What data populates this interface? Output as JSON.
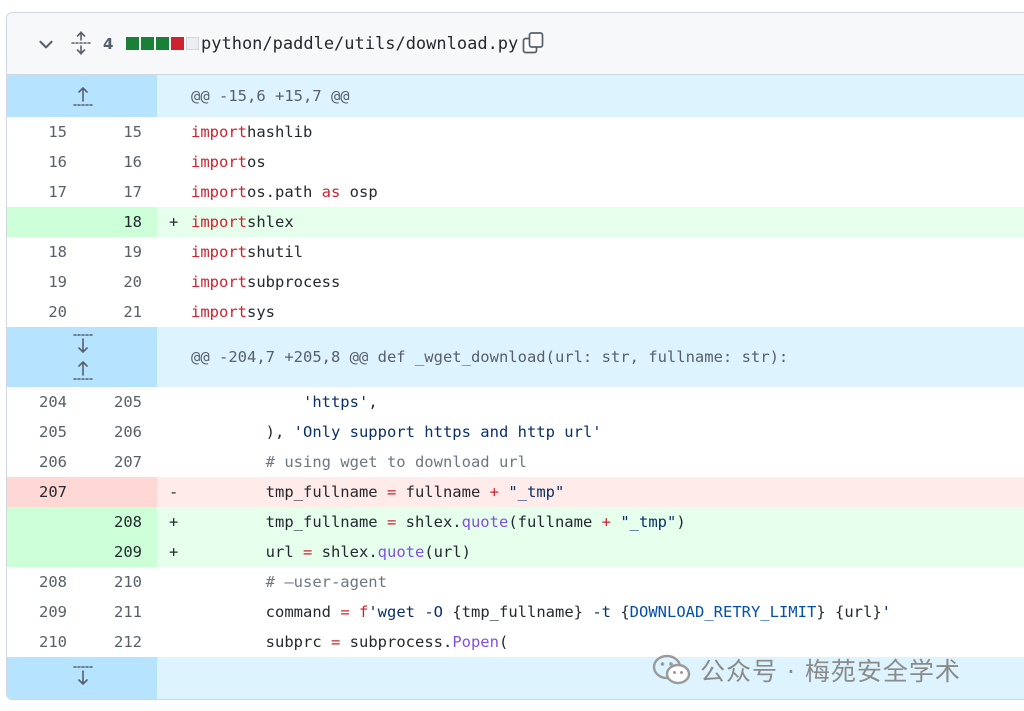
{
  "file": {
    "changes_count": "4",
    "diffstat": [
      "#1a7f37",
      "#1a7f37",
      "#1a7f37",
      "#cf222e",
      "#eaeef2"
    ],
    "path": "python/paddle/utils/download.py"
  },
  "hunk1": {
    "header": "@@ -15,6 +15,7 @@"
  },
  "hunk2": {
    "header": "@@ -204,7 +205,8 @@ def _wget_download(url: str, fullname: str):"
  },
  "block1": [
    {
      "old": "15",
      "new": "15",
      "type": "ctx",
      "tokens": [
        [
          "kw",
          "import"
        ],
        [
          "",
          "hashlib"
        ]
      ]
    },
    {
      "old": "16",
      "new": "16",
      "type": "ctx",
      "tokens": [
        [
          "kw",
          "import"
        ],
        [
          "",
          "os"
        ]
      ]
    },
    {
      "old": "17",
      "new": "17",
      "type": "ctx",
      "tokens": [
        [
          "kw",
          "import"
        ],
        [
          "",
          "os.path "
        ],
        [
          "kw",
          "as"
        ],
        [
          "",
          " osp"
        ]
      ]
    },
    {
      "old": "",
      "new": "18",
      "type": "add",
      "sign": "+",
      "tokens": [
        [
          "kw",
          "import"
        ],
        [
          "",
          "shlex"
        ]
      ]
    },
    {
      "old": "18",
      "new": "19",
      "type": "ctx",
      "tokens": [
        [
          "kw",
          "import"
        ],
        [
          "",
          "shutil"
        ]
      ]
    },
    {
      "old": "19",
      "new": "20",
      "type": "ctx",
      "tokens": [
        [
          "kw",
          "import"
        ],
        [
          "",
          "subprocess"
        ]
      ]
    },
    {
      "old": "20",
      "new": "21",
      "type": "ctx",
      "tokens": [
        [
          "kw",
          "import"
        ],
        [
          "",
          "sys"
        ]
      ]
    }
  ],
  "block2": [
    {
      "old": "204",
      "new": "205",
      "type": "ctx",
      "tokens": [
        [
          "",
          "            "
        ],
        [
          "str",
          "'https'"
        ],
        [
          "",
          ","
        ]
      ]
    },
    {
      "old": "205",
      "new": "206",
      "type": "ctx",
      "tokens": [
        [
          "",
          "        ), "
        ],
        [
          "str",
          "'Only support https and http url'"
        ]
      ]
    },
    {
      "old": "206",
      "new": "207",
      "type": "ctx",
      "tokens": [
        [
          "cm",
          "        # using wget to download url"
        ]
      ]
    },
    {
      "old": "207",
      "new": "",
      "type": "del",
      "sign": "-",
      "tokens": [
        [
          "",
          "        tmp_fullname "
        ],
        [
          "op",
          "="
        ],
        [
          "",
          " fullname "
        ],
        [
          "op",
          "+"
        ],
        [
          "",
          " "
        ],
        [
          "str",
          "\"_tmp\""
        ]
      ]
    },
    {
      "old": "",
      "new": "208",
      "type": "add",
      "sign": "+",
      "tokens": [
        [
          "",
          "        tmp_fullname "
        ],
        [
          "op",
          "="
        ],
        [
          "",
          " shlex."
        ],
        [
          "fn",
          "quote"
        ],
        [
          "",
          "(fullname "
        ],
        [
          "op",
          "+"
        ],
        [
          "",
          " "
        ],
        [
          "str",
          "\"_tmp\""
        ],
        [
          "",
          ")"
        ]
      ]
    },
    {
      "old": "",
      "new": "209",
      "type": "add",
      "sign": "+",
      "tokens": [
        [
          "",
          "        url "
        ],
        [
          "op",
          "="
        ],
        [
          "",
          " shlex."
        ],
        [
          "fn",
          "quote"
        ],
        [
          "",
          "(url)"
        ]
      ]
    },
    {
      "old": "208",
      "new": "210",
      "type": "ctx",
      "tokens": [
        [
          "cm",
          "        # –user-agent"
        ]
      ]
    },
    {
      "old": "209",
      "new": "211",
      "type": "ctx",
      "tokens": [
        [
          "",
          "        command "
        ],
        [
          "op",
          "="
        ],
        [
          "",
          " "
        ],
        [
          "kw",
          "f"
        ],
        [
          "str",
          "'wget -O "
        ],
        [
          "",
          "{tmp_fullname}"
        ],
        [
          "str",
          " -t "
        ],
        [
          "",
          "{"
        ],
        [
          "const",
          "DOWNLOAD_RETRY_LIMIT"
        ],
        [
          "",
          "}"
        ],
        [
          "str",
          " "
        ],
        [
          "",
          "{url}"
        ],
        [
          "str",
          "'"
        ]
      ]
    },
    {
      "old": "210",
      "new": "212",
      "type": "ctx",
      "tokens": [
        [
          "",
          "        subprc "
        ],
        [
          "op",
          "="
        ],
        [
          "",
          " subprocess."
        ],
        [
          "fn",
          "Popen"
        ],
        [
          "",
          "("
        ]
      ]
    }
  ],
  "watermark": {
    "text": "公众号 · 梅苑安全学术"
  },
  "icons": {
    "collapse": "chevron-down-icon",
    "expand_all": "unfold-icon",
    "copy": "copy-icon",
    "expand_up": "fold-up-icon",
    "expand_down": "fold-down-icon"
  }
}
